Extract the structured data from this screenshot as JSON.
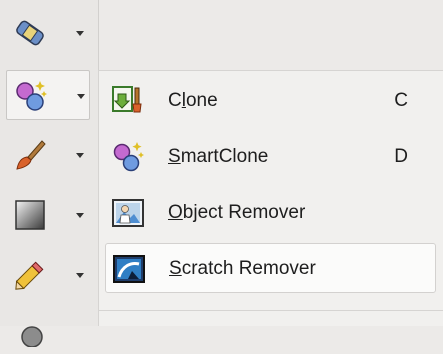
{
  "toolstrip": {
    "tools": [
      {
        "icon": "eraser-band-aid-icon"
      },
      {
        "icon": "magic-clone-icon",
        "active": true
      },
      {
        "icon": "paintbrush-icon"
      },
      {
        "icon": "gradient-icon"
      },
      {
        "icon": "pencil-icon"
      },
      {
        "icon": "partial-tool-icon"
      }
    ]
  },
  "menu": {
    "items": [
      {
        "label_pre": "C",
        "label_ul": "l",
        "label_post": "one",
        "shortcut": "C",
        "icon": "clone-stamp-icon"
      },
      {
        "label_pre": "",
        "label_ul": "S",
        "label_post": "martClone",
        "shortcut": "D",
        "icon": "smartclone-icon"
      },
      {
        "label_pre": "",
        "label_ul": "O",
        "label_post": "bject Remover",
        "shortcut": "",
        "icon": "object-remover-icon"
      },
      {
        "label_pre": "",
        "label_ul": "S",
        "label_post": "cratch Remover",
        "shortcut": "",
        "icon": "scratch-remover-icon"
      }
    ]
  },
  "colors": {
    "accent": "#2f7ec4",
    "hover_bg": "#fbfbfa"
  }
}
